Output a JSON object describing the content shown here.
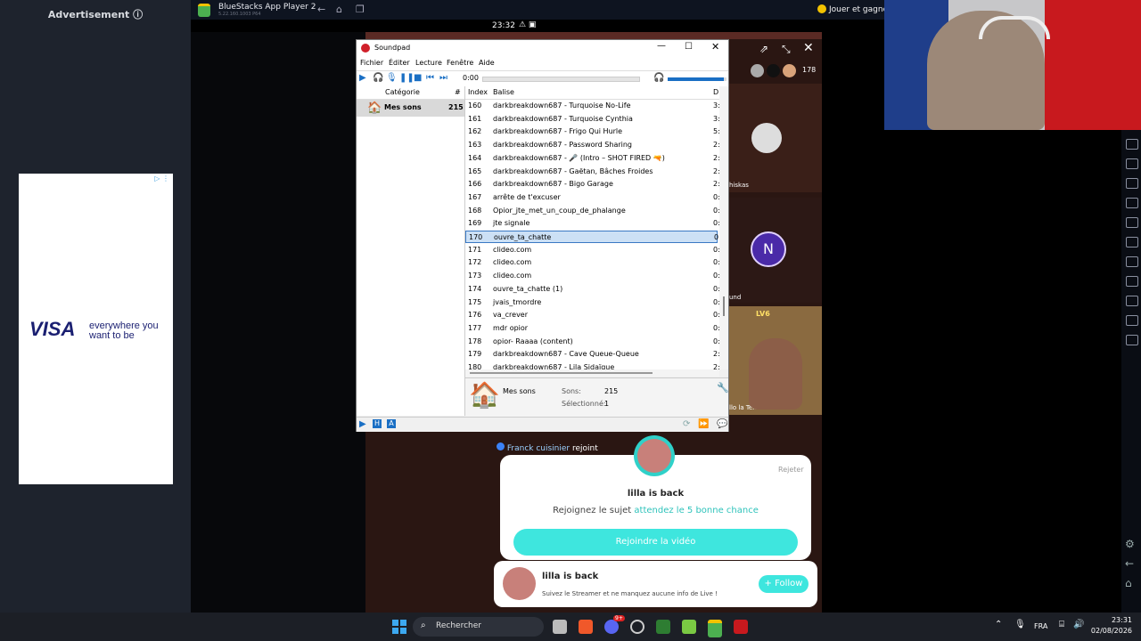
{
  "ad": {
    "label": "Advertisement ⓘ",
    "brand": "VISA",
    "tagline": "everywhere you want to be"
  },
  "bluestacks": {
    "title": "BlueStacks App Player 2",
    "version": "5.22.160.1003 P64",
    "play_label": "Jouer et gagner",
    "clock": "23:32"
  },
  "stream": {
    "viewer_count": "178",
    "tile1_name": "hiskas",
    "tile2_name": "und",
    "tile2_avatar_letter": "N",
    "tile3_badge": "LV6",
    "tile3_name": "llo la Terre",
    "join_notice_name": "Franck cuisinier",
    "join_notice_text": "rejoint",
    "popup": {
      "reject": "Rejeter",
      "name": "lilla is back",
      "text": "Rejoignez le sujet",
      "link": "attendez le 5 bonne chance",
      "button": "Rejoindre la vidéo"
    },
    "follow_card": {
      "name": "lilla is back",
      "text": "Suivez le Streamer et ne manquez aucune info de Live !",
      "button": "+ Follow"
    }
  },
  "soundpad": {
    "title": "Soundpad",
    "menu": [
      "Fichier",
      "Éditer",
      "Lecture",
      "Fenêtre",
      "Aide"
    ],
    "time": "0:00",
    "category_header": "Catégorie",
    "category_count_header": "#",
    "category": {
      "name": "Mes sons",
      "count": "215"
    },
    "list_headers": {
      "index": "Index",
      "tag": "Balise",
      "dur": "D"
    },
    "rows": [
      {
        "idx": "160",
        "tag": "darkbreakdown687 - Turquoise No-Life",
        "dur": "3:"
      },
      {
        "idx": "161",
        "tag": "darkbreakdown687 - Turquoise Cynthia",
        "dur": "3:"
      },
      {
        "idx": "162",
        "tag": "darkbreakdown687 - Frigo Qui Hurle",
        "dur": "5:"
      },
      {
        "idx": "163",
        "tag": "darkbreakdown687 - Password Sharing",
        "dur": "2:"
      },
      {
        "idx": "164",
        "tag": "darkbreakdown687 - 🎤 (Intro – SHOT FIRED 🔫)",
        "dur": "2:"
      },
      {
        "idx": "165",
        "tag": "darkbreakdown687 - Gaëtan, Bâches Froides",
        "dur": "2:"
      },
      {
        "idx": "166",
        "tag": "darkbreakdown687 - Bigo Garage",
        "dur": "2:"
      },
      {
        "idx": "167",
        "tag": "arrête de t'excuser",
        "dur": "0:"
      },
      {
        "idx": "168",
        "tag": "Opior_jte_met_un_coup_de_phalange",
        "dur": "0:"
      },
      {
        "idx": "169",
        "tag": "jte signale",
        "dur": "0:"
      },
      {
        "idx": "170",
        "tag": "ouvre_ta_chatte",
        "dur": "0:"
      },
      {
        "idx": "171",
        "tag": "clideo.com",
        "dur": "0:"
      },
      {
        "idx": "172",
        "tag": "clideo.com",
        "dur": "0:"
      },
      {
        "idx": "173",
        "tag": "clideo.com",
        "dur": "0:"
      },
      {
        "idx": "174",
        "tag": "ouvre_ta_chatte (1)",
        "dur": "0:"
      },
      {
        "idx": "175",
        "tag": "jvais_tmordre",
        "dur": "0:"
      },
      {
        "idx": "176",
        "tag": "va_crever",
        "dur": "0:"
      },
      {
        "idx": "177",
        "tag": "mdr opior",
        "dur": "0:"
      },
      {
        "idx": "178",
        "tag": "opior- Raaaa (content)",
        "dur": "0:"
      },
      {
        "idx": "179",
        "tag": "darkbreakdown687 - Cave Queue-Queue",
        "dur": "2:"
      },
      {
        "idx": "180",
        "tag": "darkbreakdown687 - Lila Sidaïque",
        "dur": "2:"
      }
    ],
    "selected_index": 10,
    "info": {
      "category_name": "Mes sons",
      "sounds_label": "Sons:",
      "sounds_value": "215",
      "selected_label": "Sélectionné:",
      "selected_value": "1"
    },
    "volume_level": 0.95
  },
  "taskbar": {
    "search_placeholder": "Rechercher",
    "lang": "FRA",
    "time": "23:31",
    "date": "02/08/2026",
    "discord_badge": "9+"
  }
}
